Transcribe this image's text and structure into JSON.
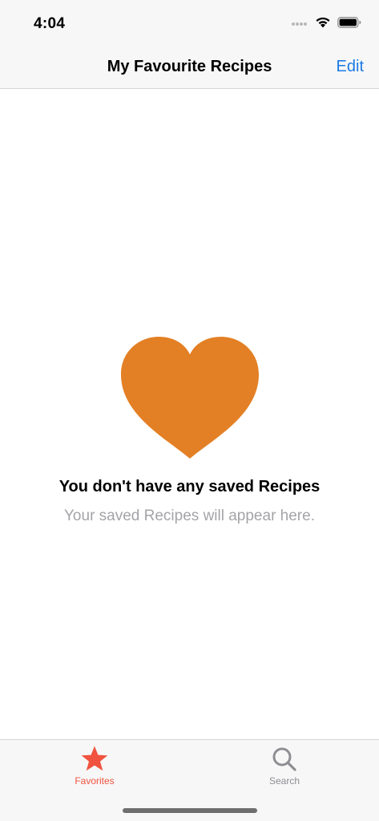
{
  "status_bar": {
    "time": "4:04"
  },
  "nav": {
    "title": "My Favourite Recipes",
    "edit_label": "Edit"
  },
  "empty_state": {
    "icon": "heart-icon",
    "title": "You don't have any saved Recipes",
    "subtitle": "Your saved Recipes will appear here."
  },
  "tab_bar": {
    "tabs": [
      {
        "label": "Favorites",
        "icon": "star-icon",
        "selected": true
      },
      {
        "label": "Search",
        "icon": "magnifier-icon",
        "selected": false
      }
    ]
  },
  "colors": {
    "accent_blue": "#1b7ae6",
    "heart_orange": "#e38025",
    "tab_selected": "#f0533f",
    "tab_unselected": "#8e8e93"
  }
}
